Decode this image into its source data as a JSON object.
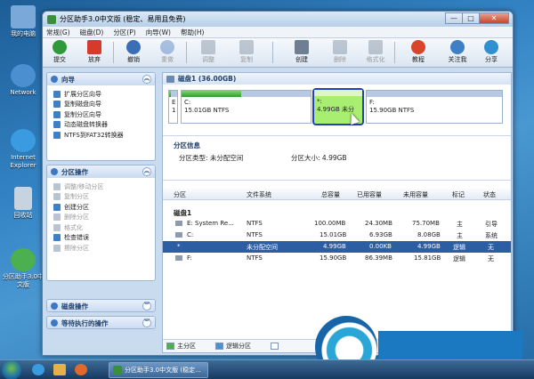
{
  "desktop": {
    "icons": [
      {
        "label": "我的电脑",
        "icon": "computer-icon",
        "color": "#7aa8d8"
      },
      {
        "label": "Network",
        "icon": "network-icon",
        "color": "#4b8fd0"
      },
      {
        "label": "Internet Explorer",
        "icon": "ie-icon",
        "color": "#3a9be0"
      },
      {
        "label": "回收站",
        "icon": "recycle-bin-icon",
        "color": "#c7d3df"
      },
      {
        "label": "分区助手3.0中文版",
        "icon": "partition-assistant-icon",
        "color": "#4caf50"
      }
    ]
  },
  "window": {
    "title": "分区助手3.0中文版 (稳定、易用且免费)",
    "controls": {
      "minimize": "—",
      "maximize": "□",
      "close": "✕"
    }
  },
  "menu": [
    "常规(G)",
    "磁盘(D)",
    "分区(P)",
    "向导(W)",
    "帮助(H)"
  ],
  "toolbar": [
    {
      "label": "提交",
      "icon": "commit-check-icon",
      "color": "#2e9a3a",
      "enabled": true
    },
    {
      "label": "放弃",
      "icon": "discard-x-icon",
      "color": "#d43b2b",
      "enabled": true
    },
    {
      "label": "撤销",
      "icon": "undo-icon",
      "color": "#3a6fb8",
      "enabled": true
    },
    {
      "label": "重做",
      "icon": "redo-icon",
      "color": "#3a6fb8",
      "enabled": false
    },
    {
      "label": "调整",
      "icon": "resize-disk-icon",
      "color": "#6f7f93",
      "enabled": false
    },
    {
      "label": "复制",
      "icon": "copy-disk-icon",
      "color": "#6f7f93",
      "enabled": false
    },
    {
      "label": "创建",
      "icon": "create-disk-icon",
      "color": "#6f7f93",
      "enabled": true
    },
    {
      "label": "删除",
      "icon": "delete-disk-icon",
      "color": "#6f7f93",
      "enabled": false
    },
    {
      "label": "格式化",
      "icon": "format-disk-icon",
      "color": "#6f7f93",
      "enabled": false
    },
    {
      "label": "教程",
      "icon": "tutorial-icon",
      "color": "#d9452b",
      "enabled": true
    },
    {
      "label": "关注我",
      "icon": "follow-me-icon",
      "color": "#3f7fc5",
      "enabled": true
    },
    {
      "label": "分享",
      "icon": "share-icon",
      "color": "#2f8fd0",
      "enabled": true
    }
  ],
  "sidebar": {
    "wizard": {
      "title": "向导",
      "items": [
        "扩展分区向导",
        "复制磁盘向导",
        "复制分区向导",
        "动态磁盘转换器",
        "NTFS到FAT32转换器"
      ]
    },
    "partition_ops": {
      "title": "分区操作",
      "items": [
        {
          "label": "调整/移动分区",
          "enabled": false
        },
        {
          "label": "复制分区",
          "enabled": false
        },
        {
          "label": "创建分区",
          "enabled": true
        },
        {
          "label": "删除分区",
          "enabled": false
        },
        {
          "label": "格式化",
          "enabled": false
        },
        {
          "label": "检查错误",
          "enabled": true
        },
        {
          "label": "擦除分区",
          "enabled": false
        }
      ]
    },
    "disk_ops": {
      "title": "磁盘操作"
    },
    "pending_ops": {
      "title": "等待执行的操作"
    }
  },
  "disk_map": {
    "header": "磁盘1 (36.00GB)",
    "partitions": [
      {
        "letter": "E",
        "num": "1",
        "used_fraction": 0.25,
        "selected": false
      },
      {
        "label": "C:",
        "detail": "15.01GB NTFS",
        "used_fraction": 0.46,
        "selected": false
      },
      {
        "label": "*:",
        "detail": "4.99GB 未分",
        "used_fraction": 0.0,
        "selected": true
      },
      {
        "label": "F:",
        "detail": "15.90GB NTFS",
        "used_fraction": 0.0,
        "selected": false
      }
    ]
  },
  "partition_info": {
    "heading": "分区信息",
    "type_text": "分区类型: 未分配空间",
    "size_text": "分区大小: 4.99GB"
  },
  "table": {
    "columns": [
      "分区",
      "文件系统",
      "总容量",
      "已用容量",
      "未用容量",
      "标记",
      "状态"
    ],
    "group": "磁盘1",
    "rows": [
      {
        "name": "E: System Re...",
        "fs": "NTFS",
        "total": "100.00MB",
        "used": "24.30MB",
        "free": "75.70MB",
        "flag": "主",
        "status": "引导",
        "selected": false
      },
      {
        "name": "C:",
        "fs": "NTFS",
        "total": "15.01GB",
        "used": "6.93GB",
        "free": "8.08GB",
        "flag": "主",
        "status": "系统",
        "selected": false
      },
      {
        "name": "*",
        "fs": "未分配空间",
        "total": "4.99GB",
        "used": "0.00KB",
        "free": "4.99GB",
        "flag": "逻辑",
        "status": "无",
        "selected": true
      },
      {
        "name": "F:",
        "fs": "NTFS",
        "total": "15.90GB",
        "used": "86.39MB",
        "free": "15.81GB",
        "flag": "逻辑",
        "status": "无",
        "selected": false
      }
    ]
  },
  "legend": [
    {
      "label": "主分区",
      "color": "#4caf50"
    },
    {
      "label": "逻辑分区",
      "color": "#4a90d9"
    },
    {
      "label": "",
      "color": "#ffffff"
    }
  ],
  "taskbar": {
    "task_label": "分区助手3.0中文版 (稳定..."
  }
}
